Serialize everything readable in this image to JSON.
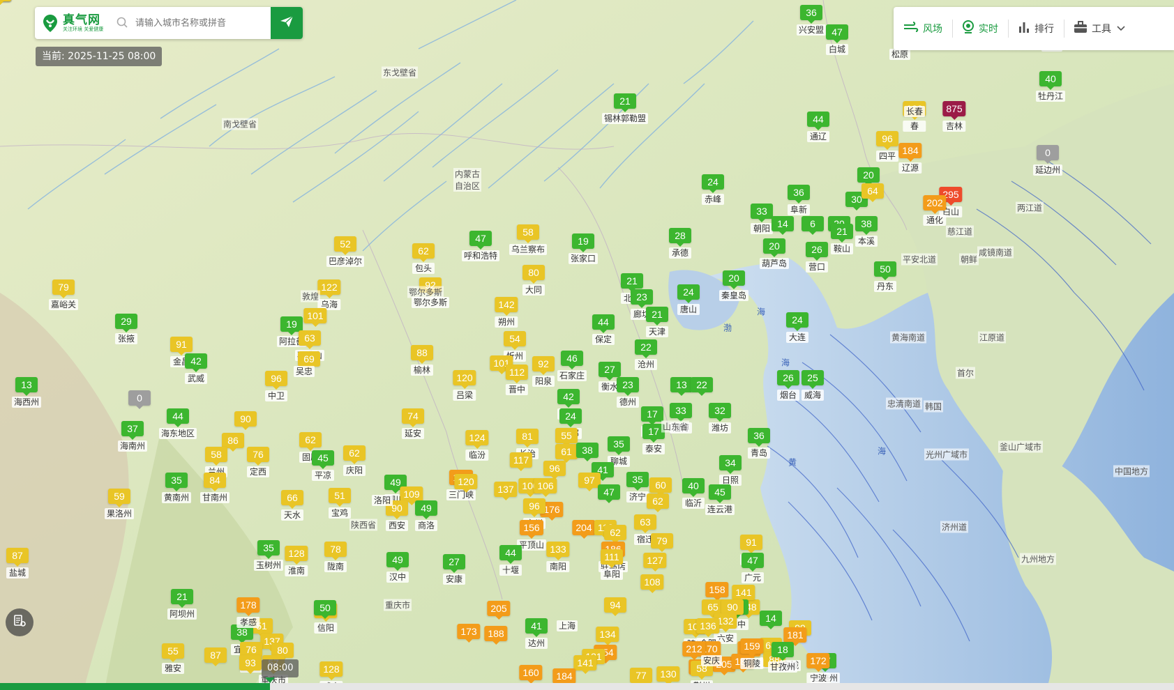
{
  "colors": {
    "good": "#3cb62f",
    "moderate": "#e9c526",
    "unhealthy_sensitive": "#f39c1a",
    "unhealthy": "#ee4b2b",
    "hazardous": "#9b1b47",
    "nodata": "#9e9e9e"
  },
  "search": {
    "logo_title": "真气网",
    "logo_tagline": "关注环境 关爱健康",
    "placeholder": "请输入城市名称或拼音",
    "send_icon": "paper-plane-icon"
  },
  "current_time": "当前: 2025-11-25 08:00",
  "toolbar": {
    "wind": "风场",
    "realtime": "实时",
    "ranking": "排行",
    "tools": "工具"
  },
  "timeline": {
    "label": "08:00",
    "progress": 0.23
  },
  "place_labels": [
    "东戈壁省",
    "南戈壁省",
    "内蒙古\n自治区",
    "敦煌",
    "鄂尔多斯",
    "山东省",
    "江原道",
    "黄海南道",
    "平安北道",
    "咸镜南道",
    "两江道",
    "慈江道",
    "忠清南道",
    "光州广域市",
    "釜山广域市",
    "济州道",
    "朝鲜",
    "韩国",
    "首尔",
    "陕西省",
    "重庆市",
    "九州地方",
    "中国地方"
  ],
  "sea_labels": [
    "渤",
    "海",
    "黄",
    "海",
    "海"
  ],
  "stations": [
    {
      "name": "兴安盟",
      "aqi": "36",
      "cat": "good"
    },
    {
      "name": "白城",
      "aqi": "47",
      "cat": "good"
    },
    {
      "name": "松原",
      "aqi": "",
      "cat": "none"
    },
    {
      "name": "鸡西",
      "aqi": "",
      "cat": "none"
    },
    {
      "name": "牡丹江",
      "aqi": "40",
      "cat": "good"
    },
    {
      "name": "春",
      "aqi": "100",
      "cat": "moderate"
    },
    {
      "name": "吉林",
      "aqi": "875",
      "cat": "hazardous"
    },
    {
      "name": "长春",
      "aqi": "",
      "cat": "none"
    },
    {
      "name": "锡林郭勒盟",
      "aqi": "21",
      "cat": "good"
    },
    {
      "name": "通辽",
      "aqi": "44",
      "cat": "good"
    },
    {
      "name": "四平",
      "aqi": "96",
      "cat": "moderate"
    },
    {
      "name": "辽源",
      "aqi": "184",
      "cat": "unhealthy_sensitive"
    },
    {
      "name": "延边州",
      "aqi": "0",
      "cat": "nodata"
    },
    {
      "name": "赤峰",
      "aqi": "24",
      "cat": "good"
    },
    {
      "name": "阜新",
      "aqi": "36",
      "cat": "good"
    },
    {
      "name": "",
      "aqi": "20",
      "cat": "good"
    },
    {
      "name": "",
      "aqi": "30",
      "cat": "good"
    },
    {
      "name": "",
      "aqi": "64",
      "cat": "moderate"
    },
    {
      "name": "白山",
      "aqi": "295",
      "cat": "unhealthy"
    },
    {
      "name": "通化",
      "aqi": "202",
      "cat": "unhealthy_sensitive"
    },
    {
      "name": "朝阳",
      "aqi": "33",
      "cat": "good"
    },
    {
      "name": "",
      "aqi": "14",
      "cat": "good"
    },
    {
      "name": "",
      "aqi": "6",
      "cat": "good"
    },
    {
      "name": "",
      "aqi": "20",
      "cat": "good"
    },
    {
      "name": "鞍山",
      "aqi": "21",
      "cat": "good"
    },
    {
      "name": "本溪",
      "aqi": "38",
      "cat": "good"
    },
    {
      "name": "葫芦岛",
      "aqi": "20",
      "cat": "good"
    },
    {
      "name": "营口",
      "aqi": "26",
      "cat": "good"
    },
    {
      "name": "丹东",
      "aqi": "50",
      "cat": "good"
    },
    {
      "name": "秦皇岛",
      "aqi": "20",
      "cat": "good"
    },
    {
      "name": "大连",
      "aqi": "24",
      "cat": "good"
    },
    {
      "name": "巴彦淖尔",
      "aqi": "52",
      "cat": "moderate"
    },
    {
      "name": "包头",
      "aqi": "62",
      "cat": "moderate"
    },
    {
      "name": "呼和浩特",
      "aqi": "47",
      "cat": "good"
    },
    {
      "name": "乌兰察布",
      "aqi": "58",
      "cat": "moderate"
    },
    {
      "name": "张家口",
      "aqi": "19",
      "cat": "good"
    },
    {
      "name": "承德",
      "aqi": "28",
      "cat": "good"
    },
    {
      "name": "鄂尔多斯",
      "aqi": "92",
      "cat": "moderate"
    },
    {
      "name": "大同",
      "aqi": "80",
      "cat": "moderate"
    },
    {
      "name": "嘉峪关",
      "aqi": "79",
      "cat": "moderate"
    },
    {
      "name": "乌海",
      "aqi": "122",
      "cat": "unhealthy_sensitive_yellow"
    },
    {
      "name": "朔州",
      "aqi": "142",
      "cat": "moderate"
    },
    {
      "name": "北京",
      "aqi": "21",
      "cat": "good"
    },
    {
      "name": "廊坊",
      "aqi": "23",
      "cat": "good"
    },
    {
      "name": "唐山",
      "aqi": "24",
      "cat": "good"
    },
    {
      "name": "天津",
      "aqi": "21",
      "cat": "good"
    },
    {
      "name": "张掖",
      "aqi": "29",
      "cat": "good"
    },
    {
      "name": "阿拉善",
      "aqi": "19",
      "cat": "good"
    },
    {
      "name": "",
      "aqi": "101",
      "cat": "moderate"
    },
    {
      "name": "石嘴山",
      "aqi": "63",
      "cat": "moderate"
    },
    {
      "name": "金昌",
      "aqi": "91",
      "cat": "moderate"
    },
    {
      "name": "武威",
      "aqi": "42",
      "cat": "good"
    },
    {
      "name": "",
      "aqi": "69",
      "cat": "moderate"
    },
    {
      "name": "保定",
      "aqi": "44",
      "cat": "good"
    },
    {
      "name": "忻州",
      "aqi": "54",
      "cat": "moderate"
    },
    {
      "name": "榆林",
      "aqi": "88",
      "cat": "moderate"
    },
    {
      "name": "沧州",
      "aqi": "22",
      "cat": "good"
    },
    {
      "name": "海西州",
      "aqi": "13",
      "cat": "good"
    },
    {
      "name": "中卫",
      "aqi": "96",
      "cat": "moderate"
    },
    {
      "name": "吴忠",
      "aqi": "",
      "cat": "none"
    },
    {
      "name": "石家庄",
      "aqi": "46",
      "cat": "good"
    },
    {
      "name": "衡水",
      "aqi": "27",
      "cat": "good"
    },
    {
      "name": "",
      "aqi": "101",
      "cat": "moderate"
    },
    {
      "name": "阳泉",
      "aqi": "92",
      "cat": "moderate"
    },
    {
      "name": "晋中",
      "aqi": "112",
      "cat": "moderate"
    },
    {
      "name": "烟台",
      "aqi": "26",
      "cat": "good"
    },
    {
      "name": "威海",
      "aqi": "25",
      "cat": "good"
    },
    {
      "name": "",
      "aqi": "13",
      "cat": "good"
    },
    {
      "name": "",
      "aqi": "22",
      "cat": "good"
    },
    {
      "name": "吕梁",
      "aqi": "120",
      "cat": "moderate"
    },
    {
      "name": "德州",
      "aqi": "23",
      "cat": "good"
    },
    {
      "name": "",
      "aqi": "0",
      "cat": "nodata"
    },
    {
      "name": "邢台",
      "aqi": "42",
      "cat": "good"
    },
    {
      "name": "淄博",
      "aqi": "33",
      "cat": "good"
    },
    {
      "name": "潍坊",
      "aqi": "32",
      "cat": "good"
    },
    {
      "name": "济南",
      "aqi": "17",
      "cat": "good"
    },
    {
      "name": "海东地区",
      "aqi": "44",
      "cat": "good"
    },
    {
      "name": "",
      "aqi": "90",
      "cat": "moderate"
    },
    {
      "name": "延安",
      "aqi": "74",
      "cat": "moderate"
    },
    {
      "name": "邯郸",
      "aqi": "24",
      "cat": "good"
    },
    {
      "name": "聊城",
      "aqi": "35",
      "cat": "good"
    },
    {
      "name": "泰安",
      "aqi": "17",
      "cat": "good"
    },
    {
      "name": "青岛",
      "aqi": "36",
      "cat": "good"
    },
    {
      "name": "海南州",
      "aqi": "37",
      "cat": "good"
    },
    {
      "name": "",
      "aqi": "86",
      "cat": "moderate"
    },
    {
      "name": "临汾",
      "aqi": "124",
      "cat": "moderate"
    },
    {
      "name": "长治",
      "aqi": "81",
      "cat": "moderate"
    },
    {
      "name": "",
      "aqi": "55",
      "cat": "moderate"
    },
    {
      "name": "固原",
      "aqi": "62",
      "cat": "moderate"
    },
    {
      "name": "",
      "aqi": "61",
      "cat": "moderate"
    },
    {
      "name": "",
      "aqi": "38",
      "cat": "good"
    },
    {
      "name": "兰州",
      "aqi": "58",
      "cat": "moderate"
    },
    {
      "name": "定西",
      "aqi": "76",
      "cat": "moderate"
    },
    {
      "name": "平凉",
      "aqi": "45",
      "cat": "good"
    },
    {
      "name": "庆阳",
      "aqi": "62",
      "cat": "moderate"
    },
    {
      "name": "",
      "aqi": "117",
      "cat": "moderate"
    },
    {
      "name": "",
      "aqi": "96",
      "cat": "moderate"
    },
    {
      "name": "",
      "aqi": "41",
      "cat": "good"
    },
    {
      "name": "济宁",
      "aqi": "35",
      "cat": "good"
    },
    {
      "name": "日照",
      "aqi": "34",
      "cat": "good"
    },
    {
      "name": "黄南州",
      "aqi": "35",
      "cat": "good"
    },
    {
      "name": "甘南州",
      "aqi": "84",
      "cat": "moderate"
    },
    {
      "name": "三门峡",
      "aqi": "188",
      "cat": "unhealthy_sensitive"
    },
    {
      "name": "",
      "aqi": "100",
      "cat": "moderate"
    },
    {
      "name": "临沂",
      "aqi": "40",
      "cat": "good"
    },
    {
      "name": "",
      "aqi": "120",
      "cat": "moderate"
    },
    {
      "name": "",
      "aqi": "137",
      "cat": "moderate"
    },
    {
      "name": "",
      "aqi": "106",
      "cat": "moderate"
    },
    {
      "name": "",
      "aqi": "97",
      "cat": "moderate"
    },
    {
      "name": "",
      "aqi": "60",
      "cat": "moderate"
    },
    {
      "name": "连云港",
      "aqi": "45",
      "cat": "good"
    },
    {
      "name": "果洛州",
      "aqi": "59",
      "cat": "moderate"
    },
    {
      "name": "天水",
      "aqi": "66",
      "cat": "moderate"
    },
    {
      "name": "宝鸡",
      "aqi": "51",
      "cat": "moderate"
    },
    {
      "name": "铜川",
      "aqi": "49",
      "cat": "good"
    },
    {
      "name": "",
      "aqi": "109",
      "cat": "moderate"
    },
    {
      "name": "西安",
      "aqi": "90",
      "cat": "moderate"
    },
    {
      "name": "商洛",
      "aqi": "49",
      "cat": "good"
    },
    {
      "name": "洛阳",
      "aqi": "",
      "cat": "none"
    },
    {
      "name": "",
      "aqi": "47",
      "cat": "good"
    },
    {
      "name": "",
      "aqi": "62",
      "cat": "moderate"
    },
    {
      "name": "",
      "aqi": "176",
      "cat": "unhealthy_sensitive"
    },
    {
      "name": "亳州",
      "aqi": "96",
      "cat": "moderate"
    },
    {
      "name": "宿迁",
      "aqi": "63",
      "cat": "moderate"
    },
    {
      "name": "平顶山",
      "aqi": "156",
      "cat": "unhealthy_sensitive"
    },
    {
      "name": "",
      "aqi": "204",
      "cat": "unhealthy_sensitive"
    },
    {
      "name": "",
      "aqi": "112",
      "cat": "moderate"
    },
    {
      "name": "",
      "aqi": "62",
      "cat": "moderate"
    },
    {
      "name": "",
      "aqi": "79",
      "cat": "moderate"
    },
    {
      "name": "淮安",
      "aqi": "91",
      "cat": "moderate"
    },
    {
      "name": "盐城",
      "aqi": "87",
      "cat": "moderate"
    },
    {
      "name": "玉树州",
      "aqi": "35",
      "cat": "good"
    },
    {
      "name": "陇南",
      "aqi": "78",
      "cat": "moderate"
    },
    {
      "name": "汉中",
      "aqi": "49",
      "cat": "good"
    },
    {
      "name": "安康",
      "aqi": "27",
      "cat": "good"
    },
    {
      "name": "十堰",
      "aqi": "44",
      "cat": "good"
    },
    {
      "name": "南阳",
      "aqi": "133",
      "cat": "moderate"
    },
    {
      "name": "驻马店",
      "aqi": "186",
      "cat": "unhealthy_sensitive"
    },
    {
      "name": "阜阳",
      "aqi": "111",
      "cat": "moderate"
    },
    {
      "name": "",
      "aqi": "127",
      "cat": "moderate"
    },
    {
      "name": "广元",
      "aqi": "47",
      "cat": "good"
    },
    {
      "name": "阿坝州",
      "aqi": "21",
      "cat": "good"
    },
    {
      "name": "淮南",
      "aqi": "128",
      "cat": "moderate"
    },
    {
      "name": "",
      "aqi": "108",
      "cat": "moderate"
    },
    {
      "name": "",
      "aqi": "158",
      "cat": "unhealthy_sensitive"
    },
    {
      "name": "",
      "aqi": "68",
      "cat": "unhealthy_sensitive"
    },
    {
      "name": "",
      "aqi": "148",
      "cat": "moderate"
    },
    {
      "name": "",
      "aqi": "141",
      "cat": "moderate"
    },
    {
      "name": "巴中",
      "aqi": "33",
      "cat": "good"
    },
    {
      "name": "襄阳",
      "aqi": "65",
      "cat": "moderate"
    },
    {
      "name": "信阳",
      "aqi": "149",
      "cat": "moderate"
    },
    {
      "name": "",
      "aqi": "205",
      "cat": "unhealthy_sensitive"
    },
    {
      "name": "",
      "aqi": "94",
      "cat": "moderate"
    },
    {
      "name": "",
      "aqi": "90",
      "cat": "moderate"
    },
    {
      "name": "达州",
      "aqi": "41",
      "cat": "good"
    },
    {
      "name": "随州",
      "aqi": "100",
      "cat": "moderate"
    },
    {
      "name": "六安",
      "aqi": "132",
      "cat": "moderate"
    },
    {
      "name": "合肥",
      "aqi": "136",
      "cat": "moderate"
    },
    {
      "name": "",
      "aqi": "170",
      "cat": "unhealthy_sensitive"
    },
    {
      "name": "",
      "aqi": "163",
      "cat": "unhealthy_sensitive"
    },
    {
      "name": "",
      "aqi": "212",
      "cat": "unhealthy_sensitive"
    },
    {
      "name": "",
      "aqi": "164",
      "cat": "unhealthy_sensitive"
    },
    {
      "name": "",
      "aqi": "205",
      "cat": "unhealthy_sensitive"
    },
    {
      "name": "",
      "aqi": "187",
      "cat": "unhealthy_sensitive"
    },
    {
      "name": "",
      "aqi": "14",
      "cat": "good"
    },
    {
      "name": "",
      "aqi": "99",
      "cat": "moderate"
    },
    {
      "name": "南充",
      "aqi": "68",
      "cat": "moderate"
    },
    {
      "name": "",
      "aqi": "88",
      "cat": "moderate"
    },
    {
      "name": "",
      "aqi": "51",
      "cat": "moderate"
    },
    {
      "name": "宜昌",
      "aqi": "38",
      "cat": "good"
    },
    {
      "name": "",
      "aqi": "50",
      "cat": "good"
    },
    {
      "name": "孝感",
      "aqi": "178",
      "cat": "unhealthy_sensitive"
    },
    {
      "name": "",
      "aqi": "137",
      "cat": "moderate"
    },
    {
      "name": "",
      "aqi": "173",
      "cat": "unhealthy_sensitive"
    },
    {
      "name": "",
      "aqi": "188",
      "cat": "unhealthy_sensitive"
    },
    {
      "name": "",
      "aqi": "181",
      "cat": "unhealthy_sensitive"
    },
    {
      "name": "上海",
      "aqi": "",
      "cat": "none"
    },
    {
      "name": "",
      "aqi": "134",
      "cat": "moderate"
    },
    {
      "name": "",
      "aqi": "154",
      "cat": "unhealthy_sensitive"
    },
    {
      "name": "",
      "aqi": "131",
      "cat": "moderate"
    },
    {
      "name": "铜陵",
      "aqi": "159",
      "cat": "unhealthy_sensitive"
    },
    {
      "name": "宣城",
      "aqi": "",
      "cat": "none"
    },
    {
      "name": "恩施州",
      "aqi": "47",
      "cat": "good"
    },
    {
      "name": "荆州",
      "aqi": "58",
      "cat": "moderate"
    },
    {
      "name": "",
      "aqi": "130",
      "cat": "moderate"
    },
    {
      "name": "甘孜州",
      "aqi": "18",
      "cat": "good"
    },
    {
      "name": "雅安",
      "aqi": "55",
      "cat": "moderate"
    },
    {
      "name": "",
      "aqi": "87",
      "cat": "moderate"
    },
    {
      "name": "遂宁",
      "aqi": "76",
      "cat": "moderate"
    },
    {
      "name": "",
      "aqi": "80",
      "cat": "moderate"
    },
    {
      "name": "",
      "aqi": "93",
      "cat": "moderate"
    },
    {
      "name": "重庆市",
      "aqi": "57",
      "cat": "moderate"
    },
    {
      "name": "咸宁",
      "aqi": "128",
      "cat": "moderate"
    },
    {
      "name": "黄石",
      "aqi": "",
      "cat": "none"
    },
    {
      "name": "",
      "aqi": "141",
      "cat": "moderate"
    },
    {
      "name": "安庆",
      "aqi": "",
      "cat": "none"
    },
    {
      "name": "",
      "aqi": "77",
      "cat": "moderate"
    },
    {
      "name": "杭州",
      "aqi": "160",
      "cat": "unhealthy_sensitive"
    },
    {
      "name": "绍兴",
      "aqi": "184",
      "cat": "unhealthy_sensitive"
    },
    {
      "name": "宁波",
      "aqi": "172",
      "cat": "unhealthy_sensitive"
    },
    {
      "name": "舟山",
      "aqi": "127",
      "cat": "moderate"
    },
    {
      "name": "",
      "aqi": "105",
      "cat": "moderate"
    },
    {
      "name": "",
      "aqi": "111",
      "cat": "moderate"
    },
    {
      "name": "",
      "aqi": "59",
      "cat": "moderate"
    },
    {
      "name": "",
      "aqi": "88",
      "cat": "moderate"
    }
  ]
}
